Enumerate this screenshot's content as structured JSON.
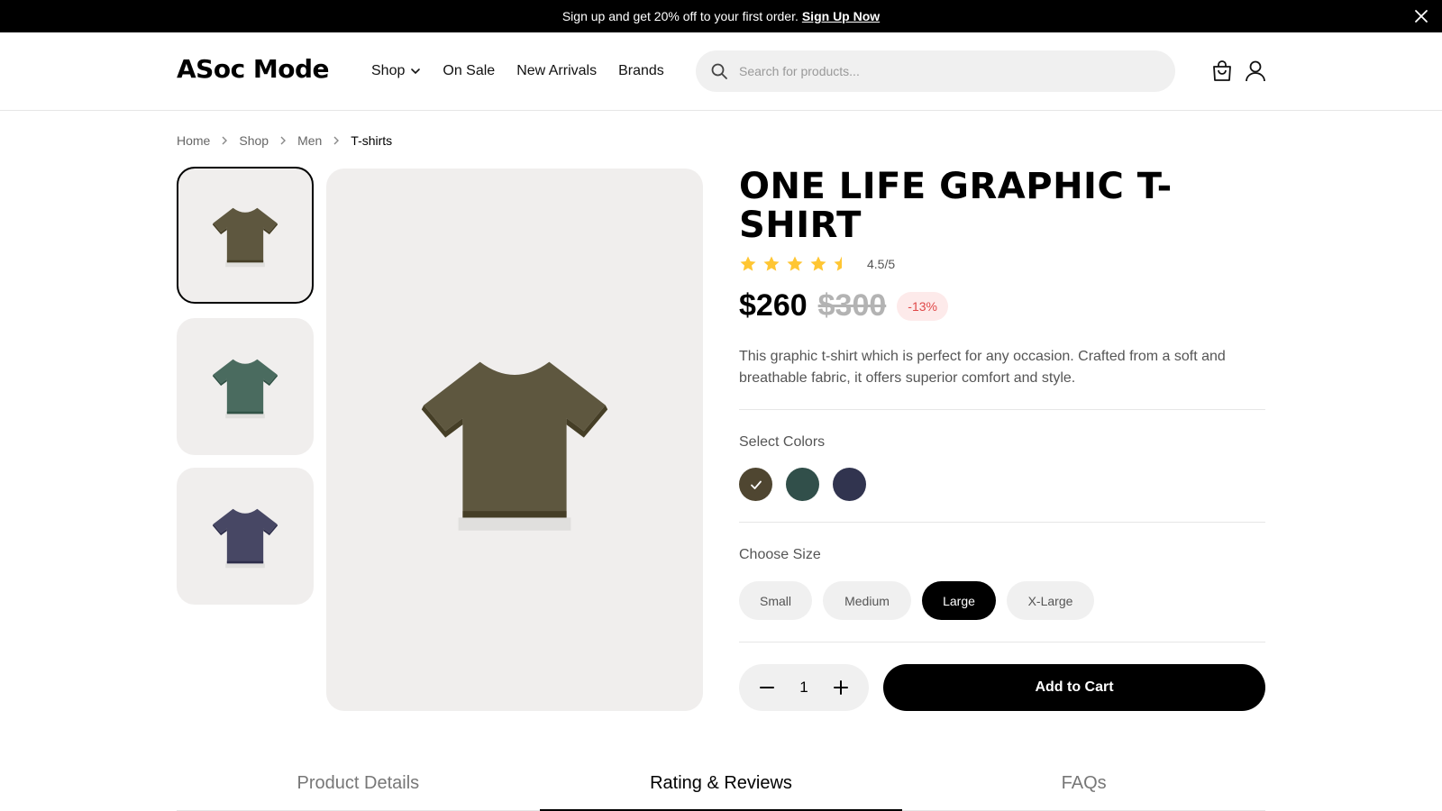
{
  "promo": {
    "text": "Sign up and get 20% off to your first order.",
    "link": "Sign Up Now"
  },
  "header": {
    "logo": "ASoc Mode",
    "nav": [
      "Shop",
      "On Sale",
      "New Arrivals",
      "Brands"
    ],
    "search_placeholder": "Search for products..."
  },
  "breadcrumb": [
    "Home",
    "Shop",
    "Men",
    "T-shirts"
  ],
  "product": {
    "title": "ONE LIFE GRAPHIC T-SHIRT",
    "rating": 4.5,
    "rating_text": "4.5/5",
    "price": "$260",
    "old_price": "$300",
    "discount": "-13%",
    "description": "This graphic t-shirt which is perfect for any occasion. Crafted from a soft and breathable fabric, it offers superior comfort and style.",
    "colors_label": "Select Colors",
    "colors": [
      "#4f4631",
      "#314f4a",
      "#31344f"
    ],
    "selected_color": 0,
    "size_label": "Choose Size",
    "sizes": [
      "Small",
      "Medium",
      "Large",
      "X-Large"
    ],
    "selected_size": "Large",
    "quantity": "1",
    "add_to_cart": "Add to Cart"
  },
  "images": {
    "thumbnail_colors": [
      "#5e573f",
      "#4a6b5f",
      "#474764"
    ],
    "main_color": "#5e573f"
  },
  "tabs": [
    "Product Details",
    "Rating & Reviews",
    "FAQs"
  ],
  "active_tab": "Rating & Reviews",
  "colors": {
    "star": "#ffc633",
    "discount_bg": "#fdeaea",
    "discount_text": "#e04848"
  }
}
